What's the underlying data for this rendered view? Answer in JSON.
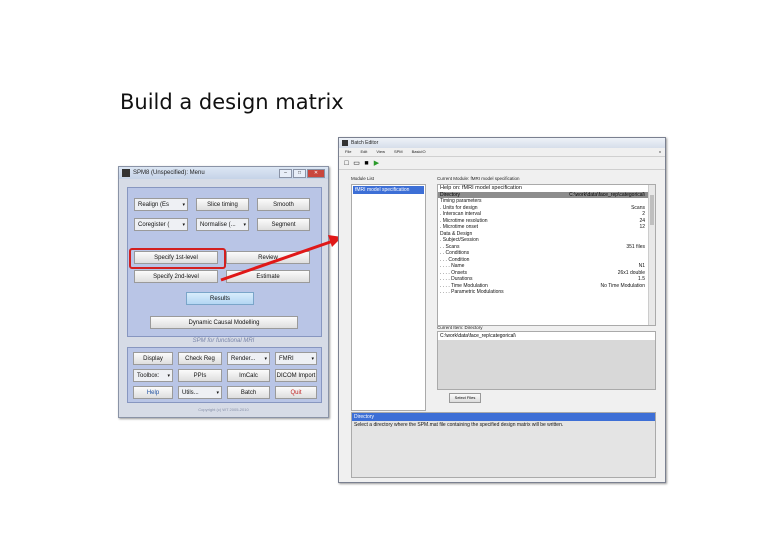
{
  "slide": {
    "title": "Build a design matrix"
  },
  "spm_menu": {
    "window_title": "SPM8 (Unspecified): Menu",
    "realign": "Realign (Es",
    "slice_timing": "Slice timing",
    "smooth": "Smooth",
    "coregister": "Coregister (",
    "normalise": "Normalise (...",
    "segment": "Segment",
    "specify_1st": "Specify 1st-level",
    "review": "Review",
    "specify_2nd": "Specify 2nd-level",
    "estimate": "Estimate",
    "results": "Results",
    "dcm": "Dynamic Causal Modelling",
    "subtitle": "SPM for functional MRI",
    "display": "Display",
    "check_reg": "Check Reg",
    "render": "Render...",
    "fmri": "FMRI",
    "toolbox": "Toolbox:",
    "ppis": "PPIs",
    "imcalc": "ImCalc",
    "dicom": "DICOM Import",
    "help": "Help",
    "utils": "Utils...",
    "batch": "Batch",
    "quit": "Quit",
    "copyright": "Copyright (c) WT 2005-2010"
  },
  "batch_editor": {
    "window_title": "Batch Editor",
    "menu": [
      "File",
      "Edit",
      "View",
      "SPM",
      "BasicIO"
    ],
    "close_x": "x",
    "module_list_label": "Module List",
    "module_item": "fMRI model specification",
    "current_module_label": "Current Module: fMRI model specification",
    "spec_rows": [
      {
        "text": "Help on: fMRI model specification",
        "val": "",
        "cls": "head"
      },
      {
        "text": "Directory",
        "val": "C:\\work\\data\\face_rep\\categorical\\",
        "cls": "sel"
      },
      {
        "text": "Timing parameters",
        "val": "",
        "cls": ""
      },
      {
        "text": ". Units for design",
        "val": "Scans",
        "cls": ""
      },
      {
        "text": ". Interscan interval",
        "val": "2",
        "cls": ""
      },
      {
        "text": ". Microtime resolution",
        "val": "24",
        "cls": ""
      },
      {
        "text": ". Microtime onset",
        "val": "12",
        "cls": ""
      },
      {
        "text": "Data & Design",
        "val": "",
        "cls": ""
      },
      {
        "text": ". Subject/Session",
        "val": "",
        "cls": ""
      },
      {
        "text": ". . Scans",
        "val": "351 files",
        "cls": ""
      },
      {
        "text": ". . Conditions",
        "val": "",
        "cls": ""
      },
      {
        "text": ". . . Condition",
        "val": "",
        "cls": ""
      },
      {
        "text": ". . . . Name",
        "val": "N1",
        "cls": ""
      },
      {
        "text": ". . . . Onsets",
        "val": "26x1 double",
        "cls": ""
      },
      {
        "text": ". . . . Durations",
        "val": "1.5",
        "cls": ""
      },
      {
        "text": ". . . . Time Modulation",
        "val": "No Time Modulation",
        "cls": ""
      },
      {
        "text": ". . . . Parametric Modulations",
        "val": "",
        "cls": ""
      }
    ],
    "current_item_label": "Current Item: Directory",
    "dir_value": "C:\\work\\data\\face_rep\\categorical\\",
    "select_files": "Select Files",
    "help_title": "Directory",
    "help_text": "Select a directory where the SPM.mat file containing the specified design matrix will be written."
  }
}
